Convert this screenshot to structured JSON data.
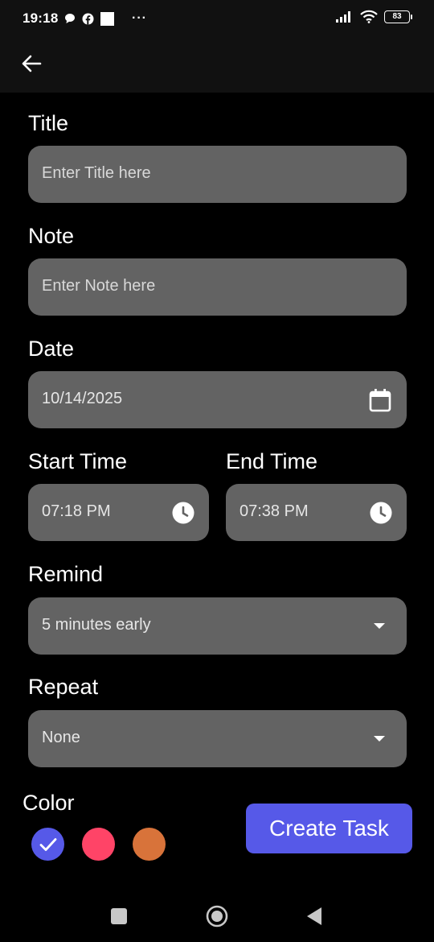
{
  "status_bar": {
    "time": "19:18",
    "battery": "83",
    "more": "···"
  },
  "form": {
    "title": {
      "label": "Title",
      "placeholder": "Enter Title here"
    },
    "note": {
      "label": "Note",
      "placeholder": "Enter Note here"
    },
    "date": {
      "label": "Date",
      "value": "10/14/2025"
    },
    "start_time": {
      "label": "Start Time",
      "value": "07:18 PM"
    },
    "end_time": {
      "label": "End Time",
      "value": "07:38 PM"
    },
    "remind": {
      "label": "Remind",
      "value": "5 minutes early"
    },
    "repeat": {
      "label": "Repeat",
      "value": "None"
    }
  },
  "color": {
    "label": "Color",
    "options": [
      {
        "hex": "#5659e8",
        "selected": true
      },
      {
        "hex": "#ff4467",
        "selected": false
      },
      {
        "hex": "#d8733a",
        "selected": false
      }
    ]
  },
  "actions": {
    "create_label": "Create Task"
  },
  "icons": [
    "arrow-back-icon",
    "calendar-icon",
    "clock-icon",
    "dropdown-arrow-icon",
    "check-icon",
    "recent-apps-icon",
    "home-icon",
    "back-nav-icon"
  ]
}
